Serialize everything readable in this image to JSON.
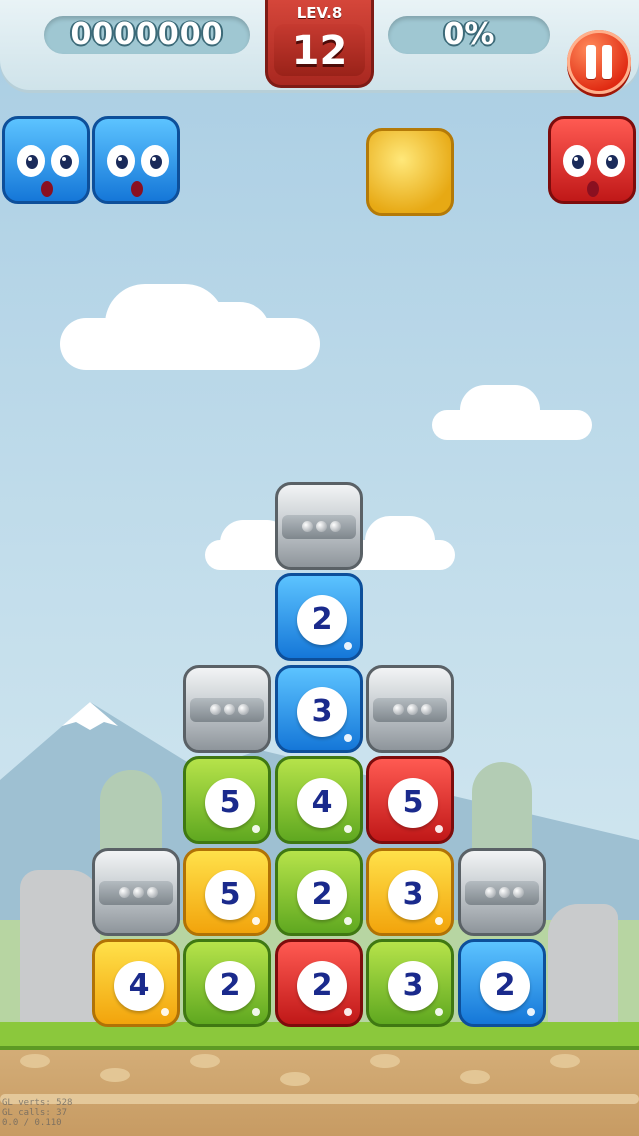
{
  "hud": {
    "score": "0000000",
    "level_label": "LEV.8",
    "moves_left": "12",
    "progress_percent": "0%"
  },
  "top_row": [
    {
      "color": "blue",
      "kind": "face"
    },
    {
      "color": "blue",
      "kind": "face"
    },
    {
      "color": "gold",
      "kind": "star-block"
    },
    {
      "color": "red",
      "kind": "face"
    }
  ],
  "board": {
    "rows": [
      [
        {
          "col": 2,
          "type": "metal"
        }
      ],
      [
        {
          "col": 2,
          "type": "number",
          "color": "blue",
          "value": "2"
        }
      ],
      [
        {
          "col": 1,
          "type": "metal"
        },
        {
          "col": 2,
          "type": "number",
          "color": "blue",
          "value": "3"
        },
        {
          "col": 3,
          "type": "metal"
        }
      ],
      [
        {
          "col": 1,
          "type": "number",
          "color": "green",
          "value": "5"
        },
        {
          "col": 2,
          "type": "number",
          "color": "green",
          "value": "4"
        },
        {
          "col": 3,
          "type": "number",
          "color": "red",
          "value": "5"
        }
      ],
      [
        {
          "col": 0,
          "type": "metal"
        },
        {
          "col": 1,
          "type": "number",
          "color": "yellow",
          "value": "5"
        },
        {
          "col": 2,
          "type": "number",
          "color": "green",
          "value": "2"
        },
        {
          "col": 3,
          "type": "number",
          "color": "yellow",
          "value": "3"
        },
        {
          "col": 4,
          "type": "metal"
        }
      ],
      [
        {
          "col": 0,
          "type": "number",
          "color": "yellow",
          "value": "4"
        },
        {
          "col": 1,
          "type": "number",
          "color": "green",
          "value": "2"
        },
        {
          "col": 2,
          "type": "number",
          "color": "red",
          "value": "2"
        },
        {
          "col": 3,
          "type": "number",
          "color": "green",
          "value": "3"
        },
        {
          "col": 4,
          "type": "number",
          "color": "blue",
          "value": "2"
        }
      ]
    ]
  },
  "debug_overlay": {
    "line1": "GL verts:   528",
    "line2": "GL calls:    37",
    "line3": "0.0 / 0.110"
  },
  "colors": {
    "blue": "#1577d8",
    "green": "#5fa820",
    "red": "#c01818",
    "yellow": "#f2a40c",
    "gold": "#e7a914",
    "hud_red": "#a92820",
    "sky": "#a9cde3"
  }
}
